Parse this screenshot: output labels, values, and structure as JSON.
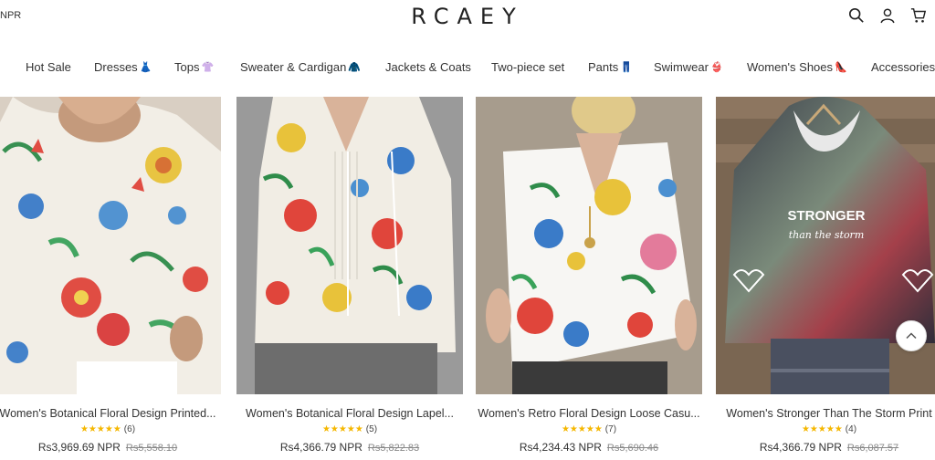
{
  "header": {
    "currency": "NPR",
    "logo": "RCAEY",
    "icons": [
      "search-icon",
      "user-icon",
      "cart-icon"
    ]
  },
  "nav": {
    "items": [
      {
        "label": "Hot Sale",
        "emoji": ""
      },
      {
        "label": "Dresses",
        "emoji": "👗"
      },
      {
        "label": "Tops",
        "emoji": "👚"
      },
      {
        "label": "Sweater & Cardigan",
        "emoji": "🧥"
      },
      {
        "label": "Jackets & Coats",
        "emoji": ""
      },
      {
        "label": "Two-piece set",
        "emoji": ""
      },
      {
        "label": "Pants",
        "emoji": "👖"
      },
      {
        "label": "Swimwear",
        "emoji": "👙"
      },
      {
        "label": "Women's Shoes",
        "emoji": "👠"
      },
      {
        "label": "Accessories",
        "emoji": ""
      }
    ]
  },
  "products": [
    {
      "title": "Women's Botanical Floral Design Printed...",
      "stars": "★★★★★",
      "reviews": "(6)",
      "price": "Rs3,969.69 NPR",
      "old_price": "Rs5,558.10"
    },
    {
      "title": "Women's Botanical Floral Design Lapel...",
      "stars": "★★★★★",
      "reviews": "(5)",
      "price": "Rs4,366.79 NPR",
      "old_price": "Rs5,822.83"
    },
    {
      "title": "Women's Retro Floral Design Loose Casu...",
      "stars": "★★★★★",
      "reviews": "(7)",
      "price": "Rs4,234.43 NPR",
      "old_price": "Rs5,690.46"
    },
    {
      "title": "Women's Stronger Than The Storm Print",
      "stars": "★★★★★",
      "reviews": "(4)",
      "price": "Rs4,366.79 NPR",
      "old_price": "Rs6,087.57",
      "print_text_1": "STRONGER",
      "print_text_2": "than the storm"
    }
  ],
  "colors": {
    "star": "#f5b700",
    "text": "#333333"
  }
}
